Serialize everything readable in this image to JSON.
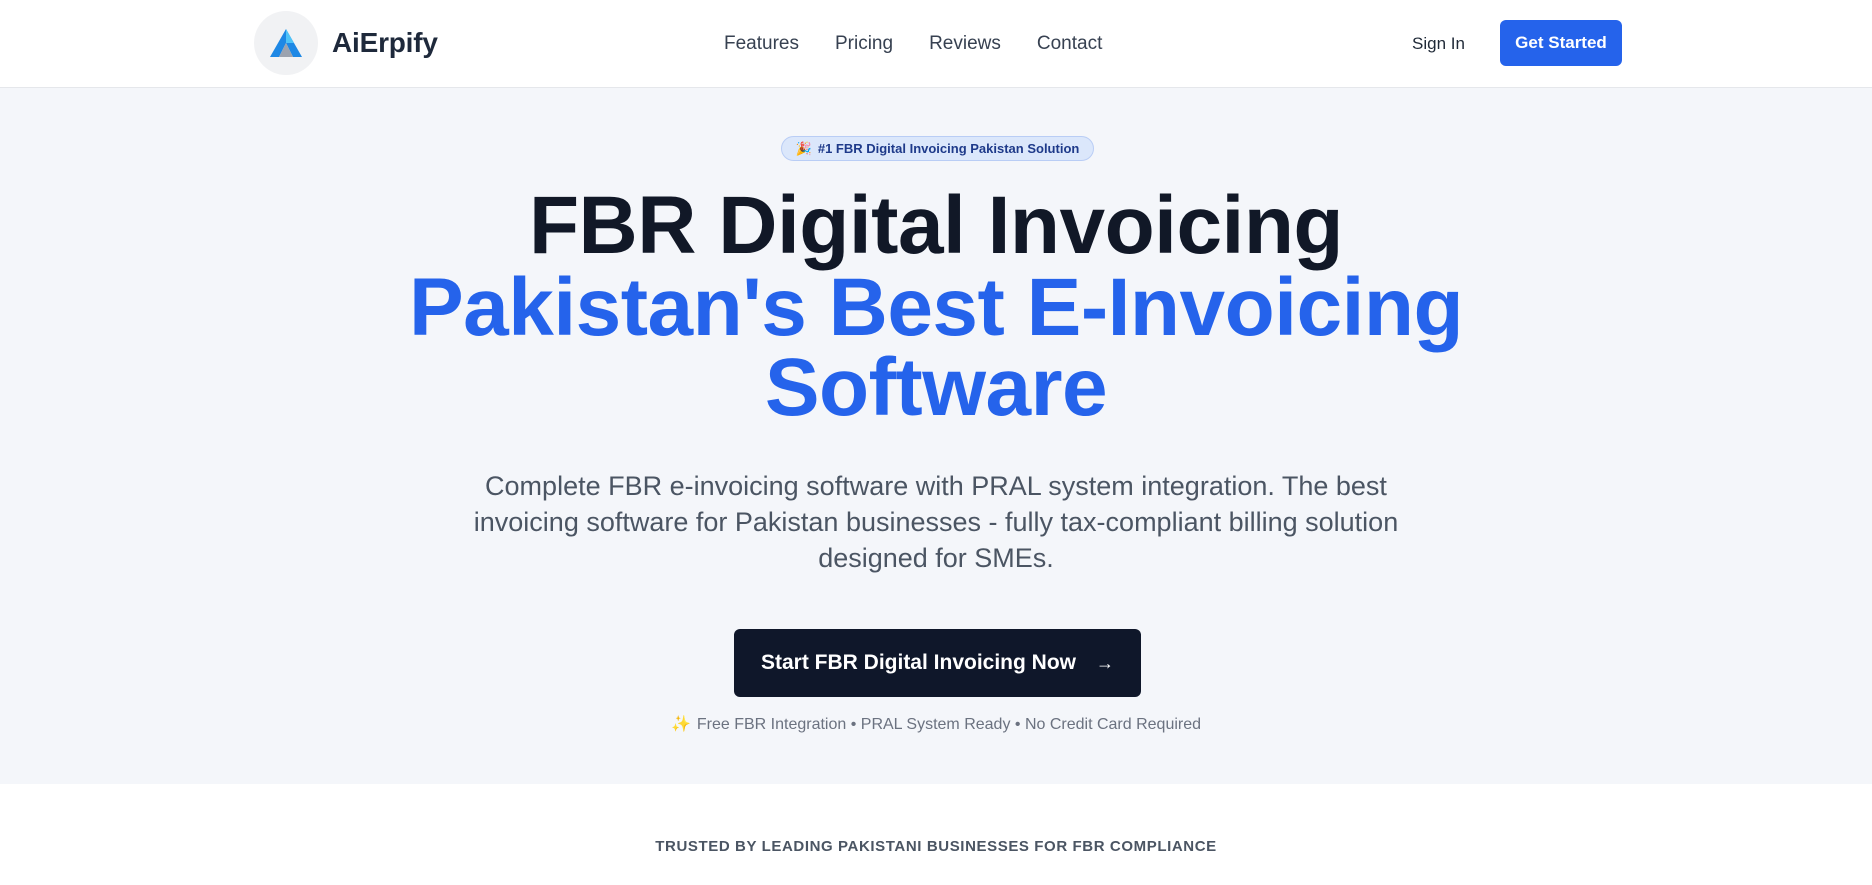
{
  "navbar": {
    "brand_name": "AiErpify",
    "logo_icon": "aierpify-a-logo",
    "links": [
      {
        "label": "Features"
      },
      {
        "label": "Pricing"
      },
      {
        "label": "Reviews"
      },
      {
        "label": "Contact"
      }
    ],
    "sign_in_label": "Sign In",
    "get_started_label": "Get Started"
  },
  "hero": {
    "badge_icon": "🎉",
    "badge_text": "#1 FBR Digital Invoicing Pakistan Solution",
    "headline_line1": "FBR Digital Invoicing",
    "headline_line2": "Pakistan's Best E-Invoicing Software",
    "subtext": "Complete FBR e-invoicing software with PRAL system integration. The best invoicing software for Pakistan businesses - fully tax-compliant billing solution designed for SMEs.",
    "cta_label": "Start FBR Digital Invoicing Now",
    "cta_icon": "→",
    "perks_icon": "✨",
    "perks_text": "Free FBR Integration • PRAL System Ready • No Credit Card Required"
  },
  "trusted": {
    "heading": "TRUSTED BY LEADING PAKISTANI BUSINESSES FOR FBR COMPLIANCE"
  },
  "colors": {
    "primary": "#2563eb",
    "dark": "#0f172a",
    "hero_bg": "#f4f6fa"
  }
}
